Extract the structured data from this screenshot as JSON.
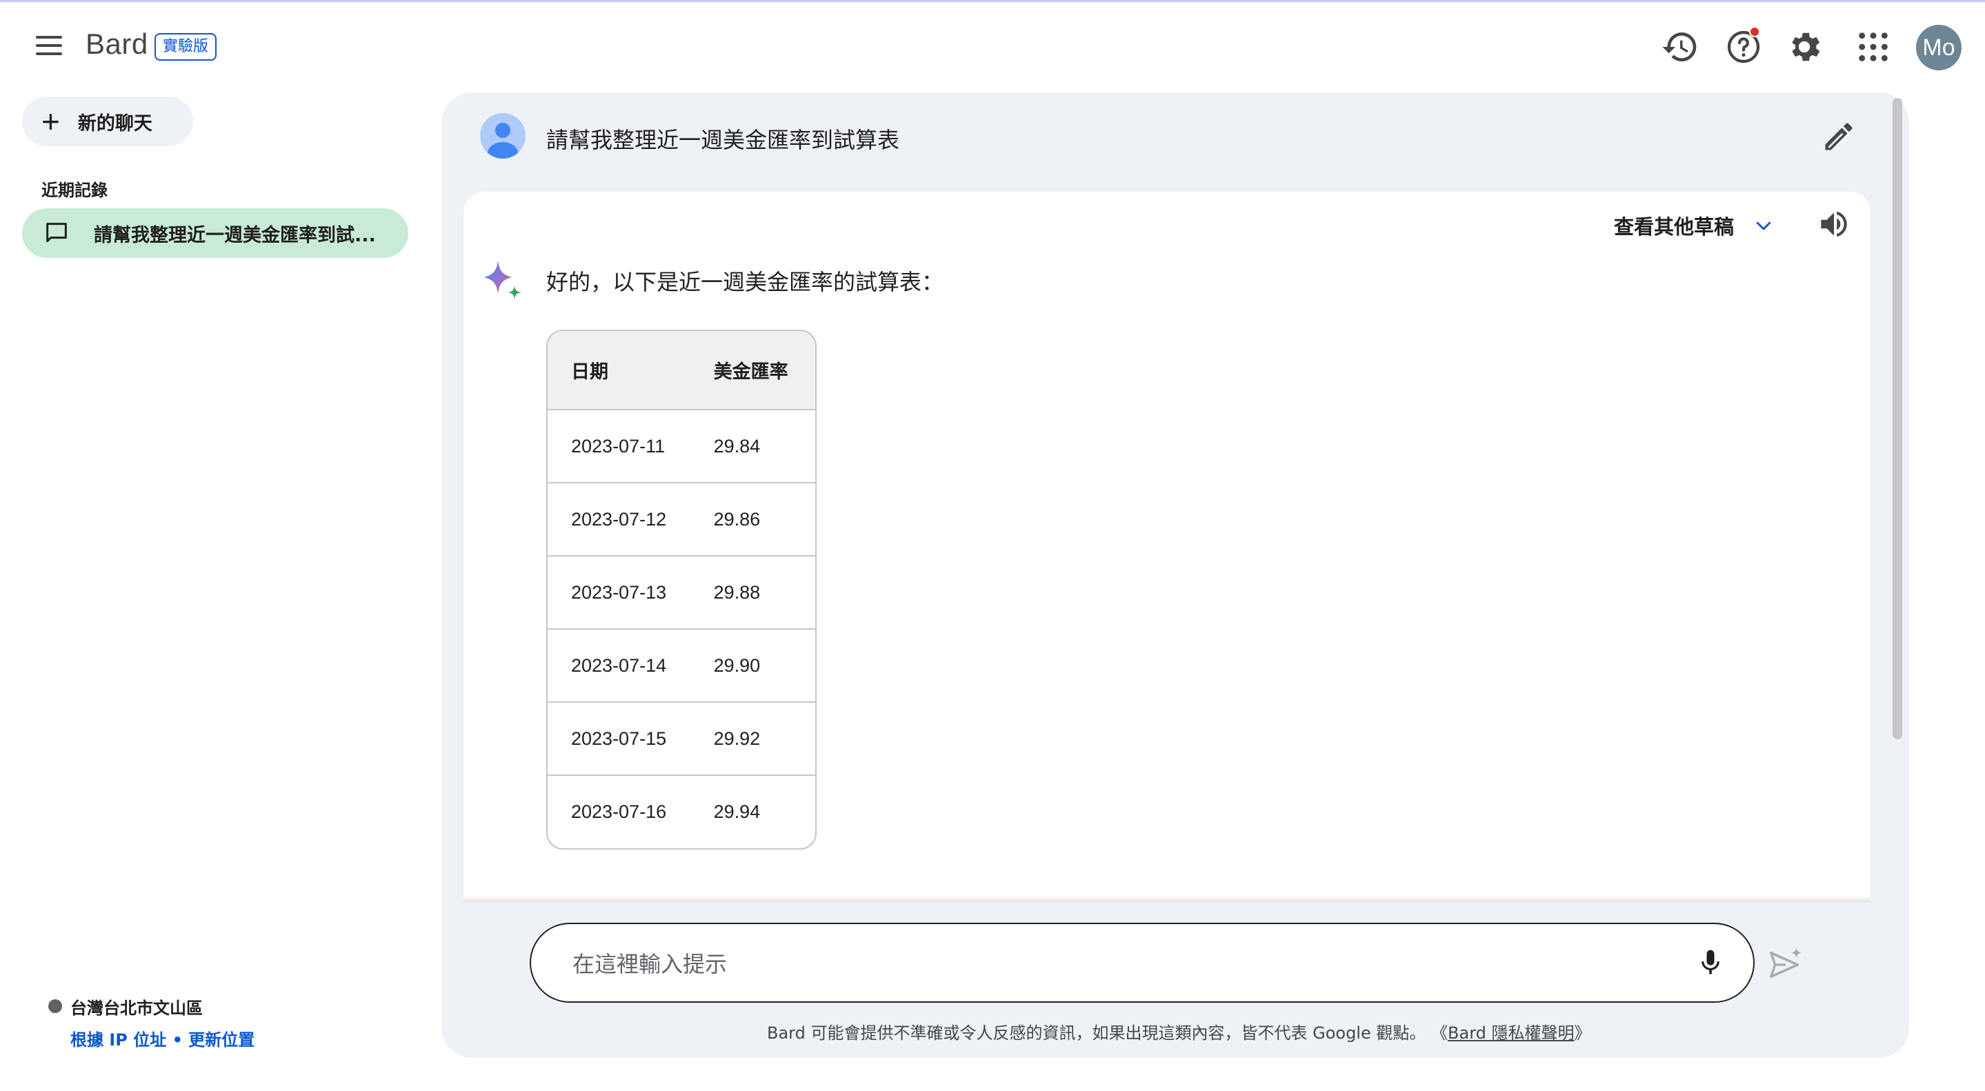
{
  "app": {
    "name": "Bard",
    "badge": "實驗版",
    "avatar_initials": "Mo",
    "accent_color": "#0b57d0"
  },
  "header": {
    "icons": [
      "menu-icon",
      "history-icon",
      "help-icon",
      "settings-icon",
      "apps-grid-icon"
    ]
  },
  "sidebar": {
    "new_chat_label": "新的聊天",
    "recent_title": "近期記錄",
    "recent_items": [
      {
        "label": "請幫我整理近一週美金匯率到試..."
      }
    ],
    "location": {
      "name": "台灣台北市文山區",
      "source_link": "根據 IP 位址",
      "separator": " • ",
      "update_link": "更新位置"
    }
  },
  "conversation": {
    "user_prompt": "請幫我整理近一週美金匯率到試算表",
    "drafts_label": "查看其他草稿",
    "reply_intro": "好的，以下是近一週美金匯率的試算表：",
    "table": {
      "headers": [
        "日期",
        "美金匯率"
      ],
      "rows": [
        [
          "2023-07-11",
          "29.84"
        ],
        [
          "2023-07-12",
          "29.86"
        ],
        [
          "2023-07-13",
          "29.88"
        ],
        [
          "2023-07-14",
          "29.90"
        ],
        [
          "2023-07-15",
          "29.92"
        ],
        [
          "2023-07-16",
          "29.94"
        ]
      ]
    }
  },
  "input": {
    "placeholder": "在這裡輸入提示",
    "value": ""
  },
  "footer": {
    "disclaimer": "Bard 可能會提供不準確或令人反感的資訊，如果出現這類內容，皆不代表 Google 觀點。",
    "privacy_open": "《",
    "privacy_link": "Bard 隱私權聲明",
    "privacy_close": "》"
  }
}
